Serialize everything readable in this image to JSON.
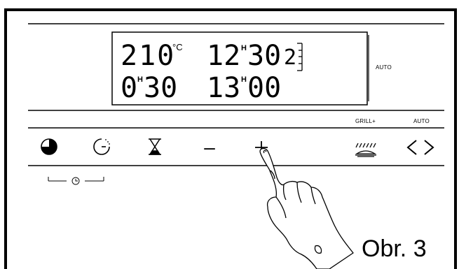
{
  "display": {
    "temperature": "210",
    "temp_unit": "°C",
    "clock": "12:30",
    "clock_h": "12",
    "clock_m": "30",
    "level": "2",
    "duration": "0:30",
    "duration_h": "0",
    "duration_m": "30",
    "end_time": "13:00",
    "end_h": "13",
    "end_m": "00",
    "hour_mark": "H",
    "mode_label": "AUTO"
  },
  "controls": {
    "grill_label": "GRILL+",
    "auto_label": "AUTO",
    "minus_symbol": "–",
    "plus_symbol": "+",
    "icons": [
      "cooking-time-icon",
      "end-time-icon",
      "timer-icon",
      "minus-icon",
      "plus-icon",
      "grill-icon",
      "auto-arrows-icon",
      "clock-icon"
    ]
  },
  "figure_label": "Obr. 3",
  "colors": {
    "ink": "#000000",
    "paper": "#ffffff"
  }
}
